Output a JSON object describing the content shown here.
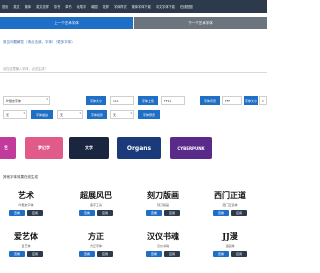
{
  "nav": {
    "items": [
      "首页",
      "英文",
      "繁体",
      "英文花样",
      "篆书",
      "草书",
      "毛笔字",
      "韩国",
      "花样",
      "字体样式",
      "繁体字体下载",
      "中文字体下载",
      "在线配图"
    ]
  },
  "tabs": {
    "prev_label": "上一个艺术字体",
    "next_label": "下一个艺术字体"
  },
  "faq_text": "常见问题解答（请点击我，字体）（更多字体）",
  "input": {
    "placeholder": "请在这里输入字体，点击生成！"
  },
  "controls": {
    "font_select": "叶根友字体",
    "size_label": "字体大小",
    "size_value": "111",
    "color_label": "字体上色",
    "color_value": "FF11",
    "bg_label": "字体背景",
    "bg_value": "FFF",
    "align_label": "字体大小",
    "align_value": "1",
    "row2_select_a": "无",
    "row2_label_a": "字体描边",
    "row2_select_b": "无",
    "row2_label_b": "字体投影",
    "row2_select_c": "无",
    "generate_label": "字体预览"
  },
  "previews": [
    {
      "text": "艺",
      "color": "#c23a9a"
    },
    {
      "text": "梦幻字",
      "color": "#e05a8a"
    },
    {
      "text": "文字",
      "color": "#1a2540"
    },
    {
      "text": "Organs",
      "color": "#1b3a7a"
    },
    {
      "text": "CYBERPUNK",
      "color": "#5a2a8a"
    }
  ],
  "section_title": "其他字体效果在线生成",
  "cards": [
    {
      "glyph": "艺术",
      "name": "叶根友字体",
      "b1": "查看",
      "b2": "应用"
    },
    {
      "glyph": "超展风巴",
      "name": "造字工房",
      "b1": "查看",
      "b2": "应用"
    },
    {
      "glyph": "刻刀版画",
      "name": "刻刀版画",
      "b1": "查看",
      "b2": "应用"
    },
    {
      "glyph": "西门正道",
      "name": "西门正道体",
      "b1": "查看",
      "b2": "应用"
    },
    {
      "glyph": "爱艺体",
      "name": "爱艺体",
      "b1": "查看",
      "b2": "应用"
    },
    {
      "glyph": "方正",
      "name": "方正字体",
      "b1": "查看",
      "b2": "应用"
    },
    {
      "glyph": "汉仪书魂",
      "name": "汉仪书魂",
      "b1": "查看",
      "b2": "应用"
    },
    {
      "glyph": "JJ漫",
      "name": "漫画体",
      "b1": "查看",
      "b2": "应用"
    }
  ]
}
